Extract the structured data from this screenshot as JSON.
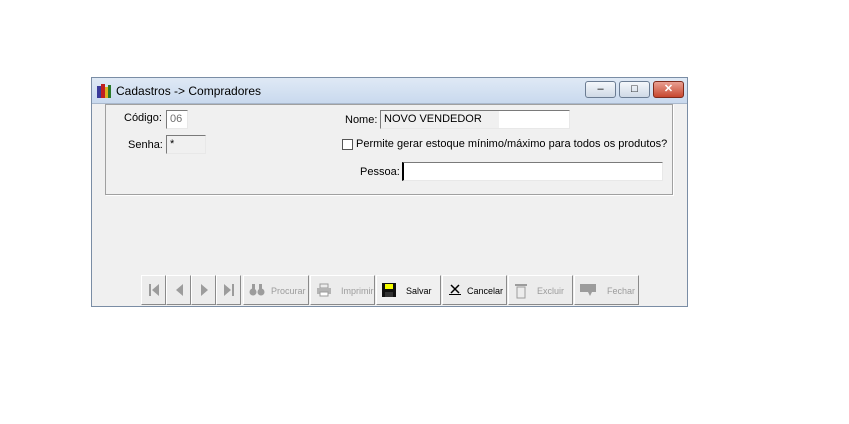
{
  "window": {
    "title": "Cadastros -> Compradores",
    "controls": {
      "minimize": "‒",
      "maximize": "□",
      "close": "✕"
    }
  },
  "form": {
    "codigo_label": "Código:",
    "codigo_value": "06",
    "senha_label": "Senha:",
    "senha_value": "*",
    "nome_label": "Nome:",
    "nome_value": "NOVO VENDEDOR",
    "estoque_checkbox_label": "Permite gerar estoque mínimo/máximo para todos os produtos?",
    "estoque_checked": false,
    "pessoa_label": "Pessoa:",
    "pessoa_value": ""
  },
  "toolbar": {
    "procurar_label": "Procurar",
    "imprimir_label": "Imprimir",
    "salvar_label": "Salvar",
    "cancelar_label": "Cancelar",
    "excluir_label": "Excluir",
    "fechar_label": "Fechar"
  },
  "colors": {
    "highlight": "#f6ff00"
  }
}
